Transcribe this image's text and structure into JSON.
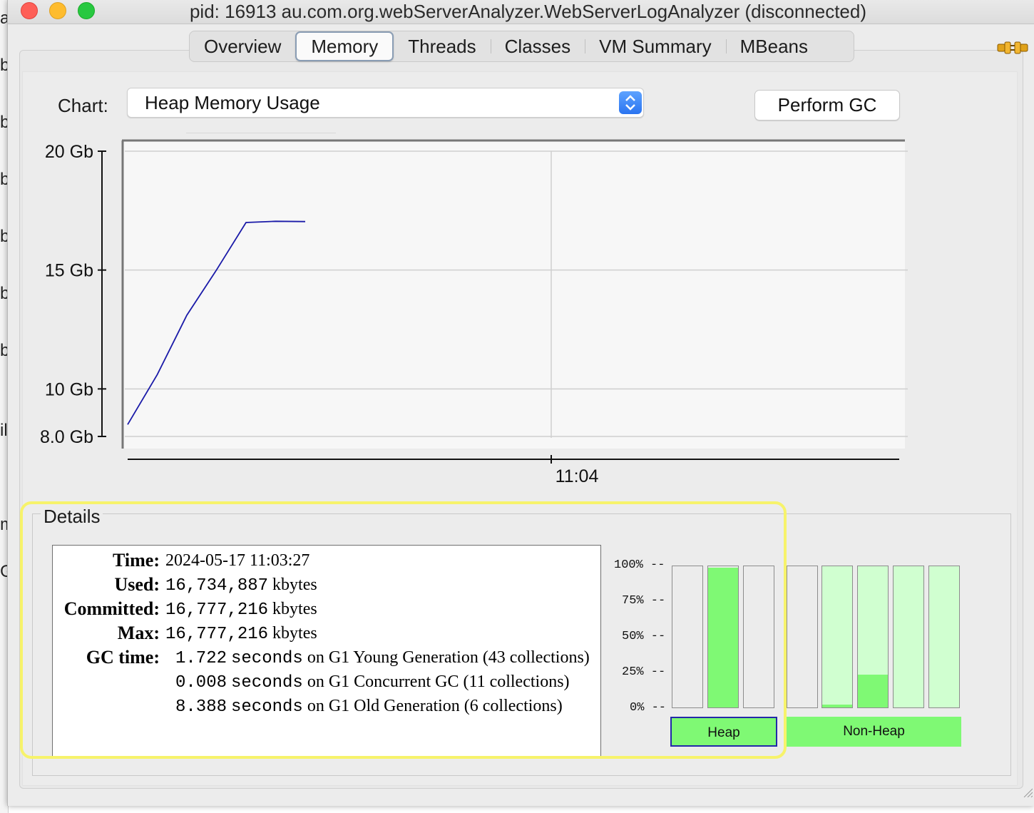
{
  "window": {
    "title": "pid: 16913 au.com.org.webServerAnalyzer.WebServerLogAnalyzer (disconnected)"
  },
  "background_window": {
    "glyphs": [
      "a",
      "b",
      "b",
      "b",
      "b",
      "b",
      "b",
      "il",
      "m",
      "G"
    ]
  },
  "tabs": [
    {
      "label": "Overview",
      "active": false
    },
    {
      "label": "Memory",
      "active": true
    },
    {
      "label": "Threads",
      "active": false
    },
    {
      "label": "Classes",
      "active": false
    },
    {
      "label": "VM Summary",
      "active": false
    },
    {
      "label": "MBeans",
      "active": false
    }
  ],
  "toolbar": {
    "chart_label": "Chart:",
    "chart_selected": "Heap Memory Usage",
    "perform_gc_label": "Perform GC"
  },
  "icons": {
    "connection": "plug-icon",
    "combo": "chevron-updown-icon"
  },
  "chart_data": {
    "type": "line",
    "series": [
      {
        "values": [
          8.5,
          10.6,
          13.1,
          15.0,
          17.0,
          17.05,
          17.04
        ]
      }
    ],
    "y_ticks": [
      "20 Gb",
      "15 Gb",
      "10 Gb",
      "8.0 Gb"
    ],
    "y_tick_values": [
      20,
      15,
      10,
      8
    ],
    "x_tick": "11:04",
    "ylim": [
      8,
      20
    ],
    "ylabel": "",
    "xlabel": "",
    "grid": true,
    "line_color": "#1a1aa8"
  },
  "details": {
    "legend": "Details",
    "time_label": "Time:",
    "time_value": "2024-05-17 11:03:27",
    "used_label": "Used:",
    "used_value": "16,734,887",
    "committed_label": "Committed:",
    "committed_value": "16,777,216",
    "max_label": "Max:",
    "max_value": "16,777,216",
    "unit": "kbytes",
    "gc_label": "GC time:",
    "gc_unit": "seconds",
    "gc_rows": [
      {
        "seconds": "1.722",
        "text": "on G1 Young Generation (43 collections)"
      },
      {
        "seconds": "0.008",
        "text": "on G1 Concurrent GC (11 collections)"
      },
      {
        "seconds": "8.388",
        "text": "on G1 Old Generation (6 collections)"
      }
    ]
  },
  "pools": {
    "pct_labels": [
      "100% --",
      "75% --",
      "50% --",
      "25% --",
      "0% --"
    ],
    "heap_label": "Heap",
    "nonheap_label": "Non-Heap",
    "heap_fills": [
      0,
      99,
      0
    ],
    "nonheap_fills": [
      0,
      2,
      23,
      0,
      0
    ],
    "colors": {
      "heap_used": "#7ff974",
      "heap_bg": "#ececec",
      "nonheap_used": "#7ff974",
      "nonheap_bg": "#d0ffd0",
      "selected_border": "#2229a8",
      "highlight": "#f7f36b"
    }
  }
}
